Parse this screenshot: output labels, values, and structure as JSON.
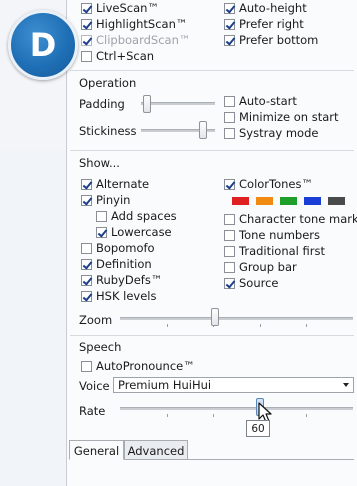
{
  "badge": {
    "letter": "D"
  },
  "top_options": {
    "left": [
      {
        "label": "LiveScan™",
        "checked": true,
        "disabled": false
      },
      {
        "label": "HighlightScan™",
        "checked": true,
        "disabled": false
      },
      {
        "label": "ClipboardScan™",
        "checked": true,
        "disabled": true
      },
      {
        "label": "Ctrl+Scan",
        "checked": false,
        "disabled": false
      }
    ],
    "right": [
      {
        "label": "Auto-height",
        "checked": true
      },
      {
        "label": "Prefer right",
        "checked": true
      },
      {
        "label": "Prefer bottom",
        "checked": true
      }
    ]
  },
  "operation": {
    "title": "Operation",
    "padding_label": "Padding",
    "stickiness_label": "Stickiness",
    "options": [
      {
        "label": "Auto-start",
        "checked": false
      },
      {
        "label": "Minimize on start",
        "checked": false
      },
      {
        "label": "Systray mode",
        "checked": false
      }
    ]
  },
  "show": {
    "title": "Show...",
    "left": [
      {
        "label": "Alternate",
        "checked": true
      },
      {
        "label": "Pinyin",
        "checked": true
      },
      {
        "label": "Add spaces",
        "checked": false
      },
      {
        "label": "Lowercase",
        "checked": true
      },
      {
        "label": "Bopomofo",
        "checked": false
      },
      {
        "label": "Definition",
        "checked": true
      },
      {
        "label": "RubyDefs™",
        "checked": true
      },
      {
        "label": "HSK levels",
        "checked": true
      }
    ],
    "right": [
      {
        "label": "ColorTones™",
        "checked": true
      },
      {
        "label": "Character tone marks",
        "checked": false
      },
      {
        "label": "Tone numbers",
        "checked": false
      },
      {
        "label": "Traditional first",
        "checked": false
      },
      {
        "label": "Group bar",
        "checked": false
      },
      {
        "label": "Source",
        "checked": true
      }
    ],
    "tone_colors": [
      "#e02020",
      "#f08a10",
      "#1f9e2a",
      "#1a3fd6",
      "#4a4a4a"
    ],
    "zoom_label": "Zoom"
  },
  "speech": {
    "title": "Speech",
    "autopronounce": {
      "label": "AutoPronounce™",
      "checked": false
    },
    "voice_label": "Voice",
    "voice_value": "Premium HuiHui",
    "rate_label": "Rate",
    "rate_value": "60"
  },
  "tabs": [
    {
      "label": "General",
      "active": true
    },
    {
      "label": "Advanced",
      "active": false
    }
  ]
}
